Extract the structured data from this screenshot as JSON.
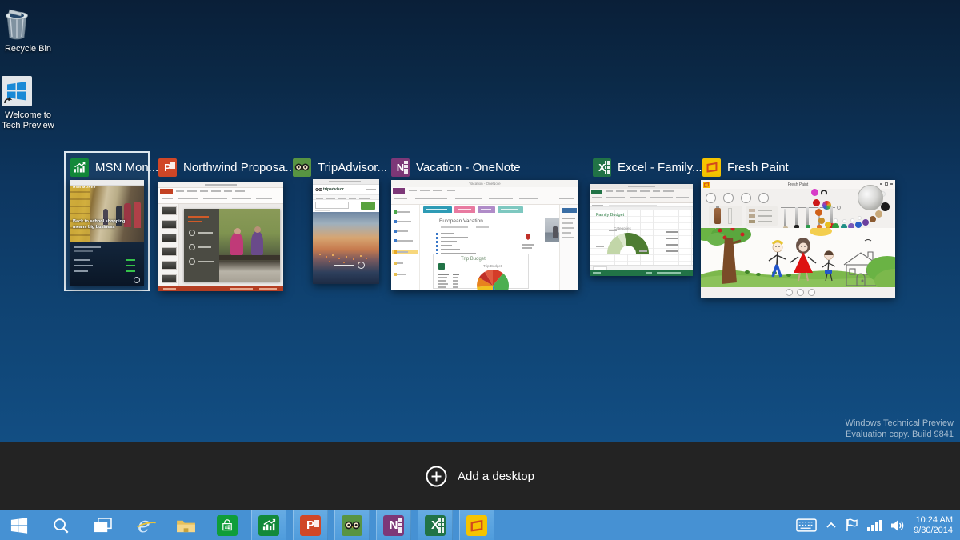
{
  "desktop": {
    "icons": [
      {
        "label": "Recycle Bin"
      },
      {
        "label": "Welcome to Tech Preview"
      }
    ],
    "watermark_line1": "Windows Technical Preview",
    "watermark_line2": "Evaluation copy. Build 9841"
  },
  "task_view": {
    "add_desktop_label": "Add a desktop",
    "windows": [
      {
        "title": "MSN Mon...",
        "app": "MSN Money",
        "selected": true
      },
      {
        "title": "Northwind Proposa...",
        "app": "PowerPoint",
        "selected": false
      },
      {
        "title": "TripAdvisor...",
        "app": "TripAdvisor",
        "selected": false
      },
      {
        "title": "Vacation - OneNote",
        "app": "OneNote",
        "selected": false
      },
      {
        "title": "Excel - Family...",
        "app": "Excel",
        "selected": false
      },
      {
        "title": "Fresh Paint",
        "app": "Fresh Paint",
        "selected": false
      }
    ]
  },
  "thumbnails": {
    "msn_money": {
      "brand": "MSN MONEY",
      "headline": "Back to school shopping means big business"
    },
    "tripadvisor": {
      "brand": "tripadvisor"
    },
    "onenote": {
      "window_title": "Vacation - OneNote",
      "page_heading": "European Vacation",
      "budget_box_title": "Trip Budget",
      "pie_chart_title": "Trip Budget"
    },
    "excel": {
      "sheet_heading": "Family Budget",
      "chart_title": "Categories"
    },
    "fresh_paint": {
      "window_title": "Fresh Paint"
    }
  },
  "taskbar": {
    "buttons": [
      "start",
      "search",
      "task-view",
      "internet-explorer",
      "file-explorer",
      "store",
      "msn-money",
      "powerpoint",
      "tripadvisor",
      "onenote",
      "excel",
      "fresh-paint"
    ],
    "tray_icons": [
      "touch-keyboard",
      "show-hidden-icons",
      "action-center-flag",
      "network-signal",
      "volume"
    ],
    "clock_time": "10:24 AM",
    "clock_date": "9/30/2014"
  },
  "icon_glyphs": {
    "powerpoint": "P",
    "onenote": "N",
    "excel": "X",
    "ie": "e"
  },
  "colors": {
    "taskbar": "#4691d3",
    "taskbar_highlight": "#61a7e0",
    "dark_bar": "#232323",
    "desktop_top": "#0a1f38",
    "desktop_bottom": "#124e83",
    "selection_border": "#dfe8ef",
    "excel_green": "#217346",
    "powerpoint_orange": "#d04727",
    "onenote_purple": "#7d3878",
    "freshpaint_yellow": "#f5c400"
  }
}
